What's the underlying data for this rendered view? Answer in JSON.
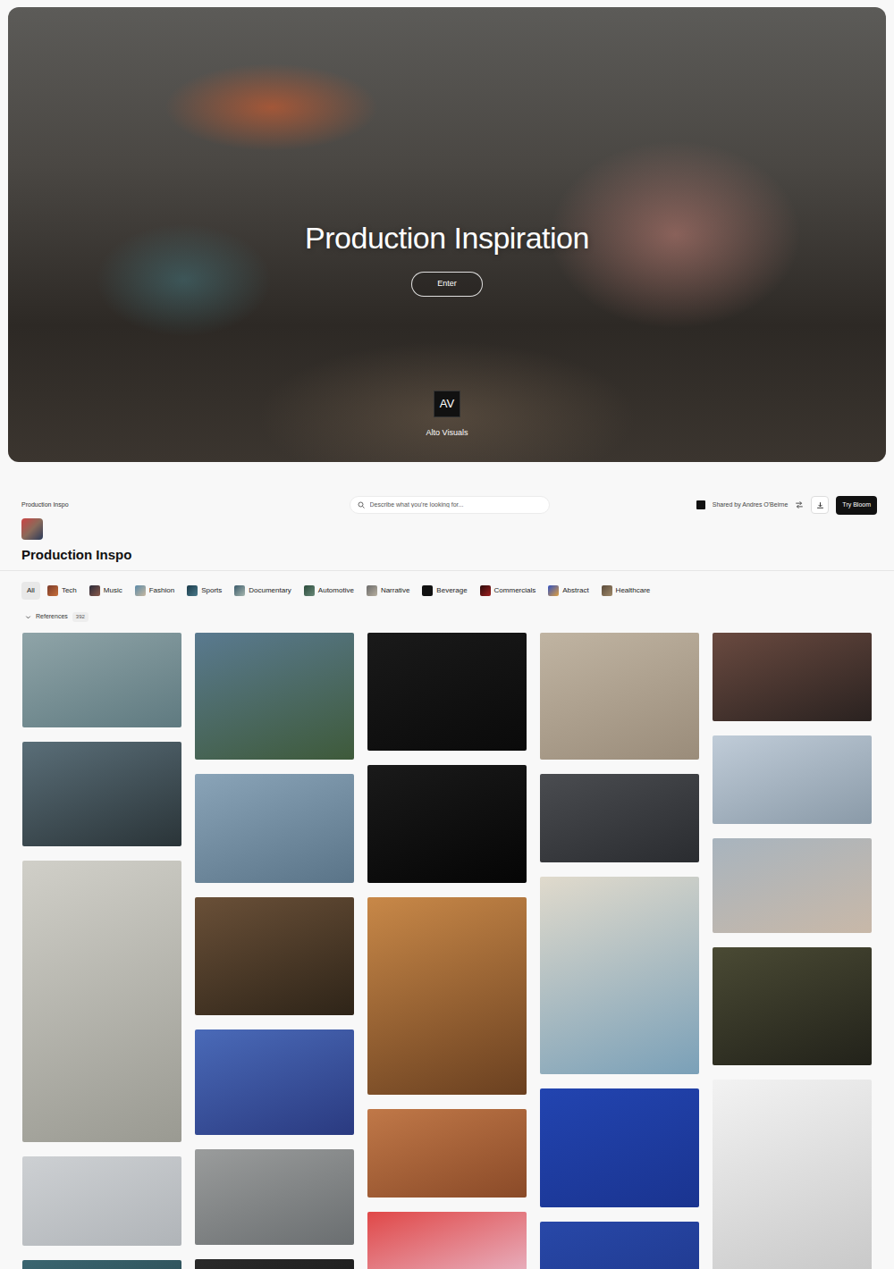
{
  "hero": {
    "title": "Production Inspiration",
    "button": "Enter",
    "logo": "AV",
    "brand": "Alto Visuals"
  },
  "header": {
    "breadcrumb": "Production Inspo",
    "search": {
      "placeholder": "Describe what you're looking for..."
    },
    "shared_by": "Shared by Andres O'Beirne",
    "try_button": "Try Bloom"
  },
  "collection": {
    "title": "Production Inspo"
  },
  "filters": [
    {
      "label": "All",
      "selected": true
    },
    {
      "label": "Tech",
      "selected": false
    },
    {
      "label": "Music",
      "selected": false
    },
    {
      "label": "Fashion",
      "selected": false
    },
    {
      "label": "Sports",
      "selected": false
    },
    {
      "label": "Documentary",
      "selected": false
    },
    {
      "label": "Automotive",
      "selected": false
    },
    {
      "label": "Narrative",
      "selected": false
    },
    {
      "label": "Beverage",
      "selected": false
    },
    {
      "label": "Commercials",
      "selected": false
    },
    {
      "label": "Abstract",
      "selected": false
    },
    {
      "label": "Healthcare",
      "selected": false
    }
  ],
  "references": {
    "label": "References",
    "count": "392",
    "expanded": true
  }
}
